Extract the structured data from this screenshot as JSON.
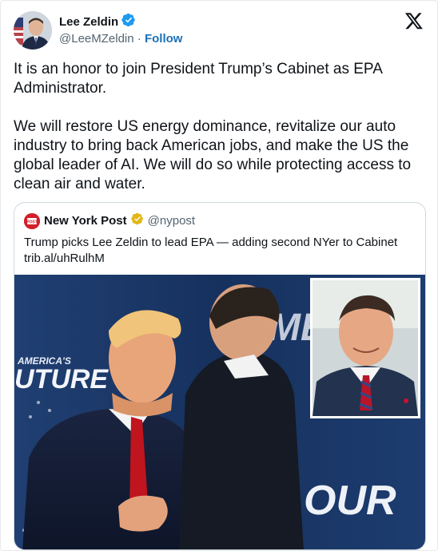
{
  "author": {
    "name": "Lee Zeldin",
    "handle": "@LeeMZeldin",
    "separator": "·",
    "follow_label": "Follow"
  },
  "tweet": {
    "text": "It is an honor to join President Trump’s Cabinet as EPA Administrator.\n\nWe will restore US energy dominance, revitalize our auto industry to bring back American jobs, and make the US the global leader of AI. We will do so while protecting access to clean air and water."
  },
  "quoted": {
    "name": "New York Post",
    "handle": "@nypost",
    "text_line1": "Trump picks Lee Zeldin to lead EPA — adding second NYer to Cabinet",
    "text_line2": "trib.al/uhRulhM",
    "image_text": {
      "banner_left_line1": "AMERICA'S",
      "banner_left_line2": "UTURE",
      "banner_right_line1": "ME",
      "banner_right_line2": "OUR",
      "logo_text": "POST"
    }
  },
  "colors": {
    "verified_blue": "#1d9bf0",
    "verified_gold": "#e2b719",
    "follow_blue": "#1d70b8",
    "nypost_red": "#d21f2a",
    "stage_blue": "#1a3a6b"
  },
  "icons": [
    "verified-badge-icon",
    "x-logo-icon",
    "gold-verified-badge-icon"
  ]
}
